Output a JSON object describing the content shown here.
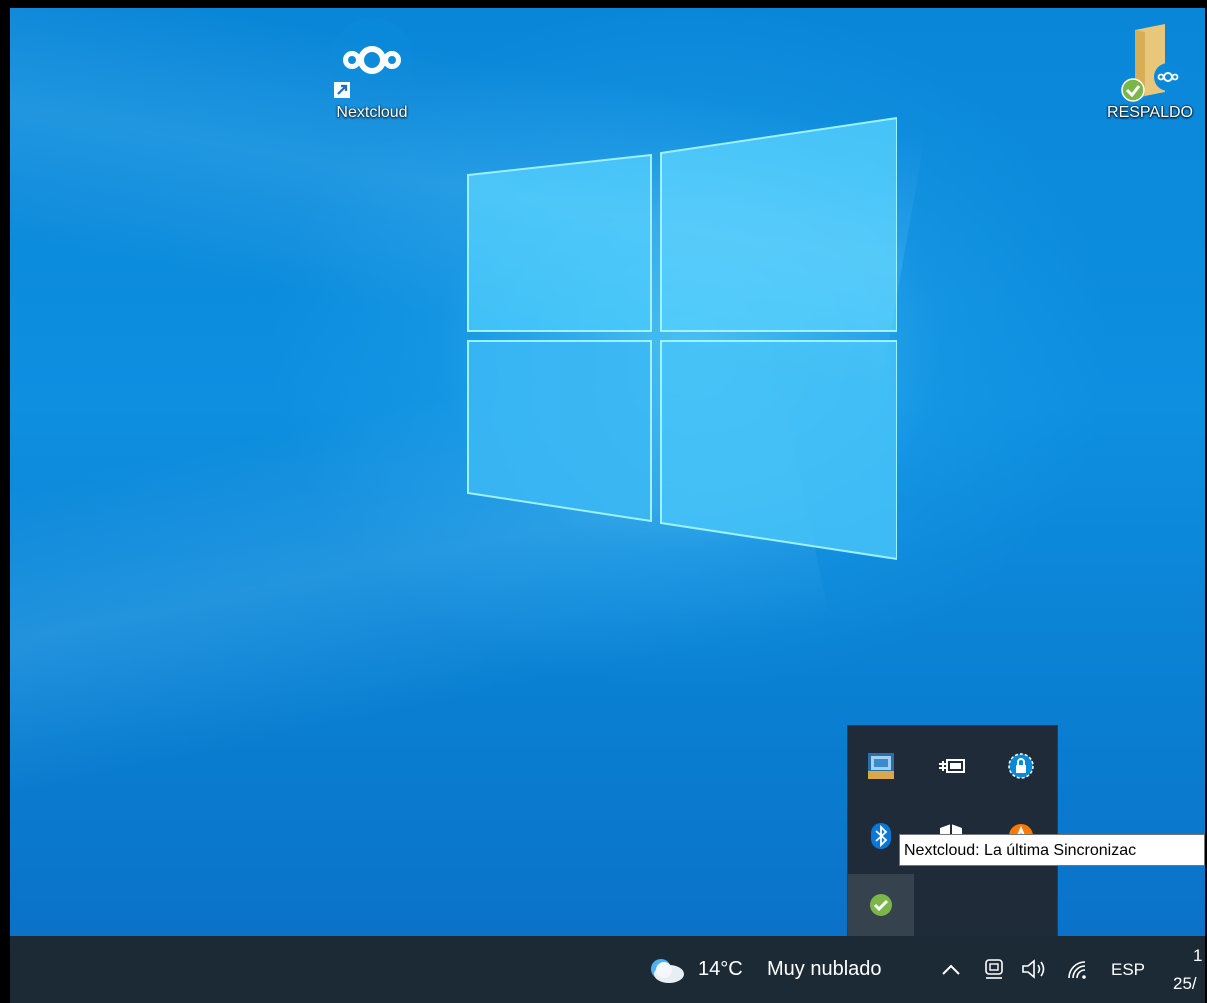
{
  "desktop": {
    "icons": [
      {
        "label": "Nextcloud",
        "icon": "nextcloud-shortcut-icon"
      },
      {
        "label": "RESPALDO",
        "icon": "folder-icon"
      }
    ]
  },
  "tray_popup": {
    "items": [
      {
        "icon": "intel-graphics-icon"
      },
      {
        "icon": "power-plug-icon"
      },
      {
        "icon": "vpn-lock-icon"
      },
      {
        "icon": "bluetooth-icon"
      },
      {
        "icon": "windows-defender-icon"
      },
      {
        "icon": "avast-icon"
      },
      {
        "icon": "nextcloud-sync-ok-icon"
      }
    ],
    "tooltip": "Nextcloud: La última Sincronizac"
  },
  "taskbar": {
    "weather_temp": "14°C",
    "weather_desc": "Muy nublado",
    "language": "ESP",
    "clock_time": "1",
    "clock_date": "25/"
  },
  "colors": {
    "taskbar": "#1c2a36",
    "tray_popup": "#1f2b38",
    "sync_ok": "#7ab648",
    "nextcloud_blue": "#0a88d9"
  }
}
